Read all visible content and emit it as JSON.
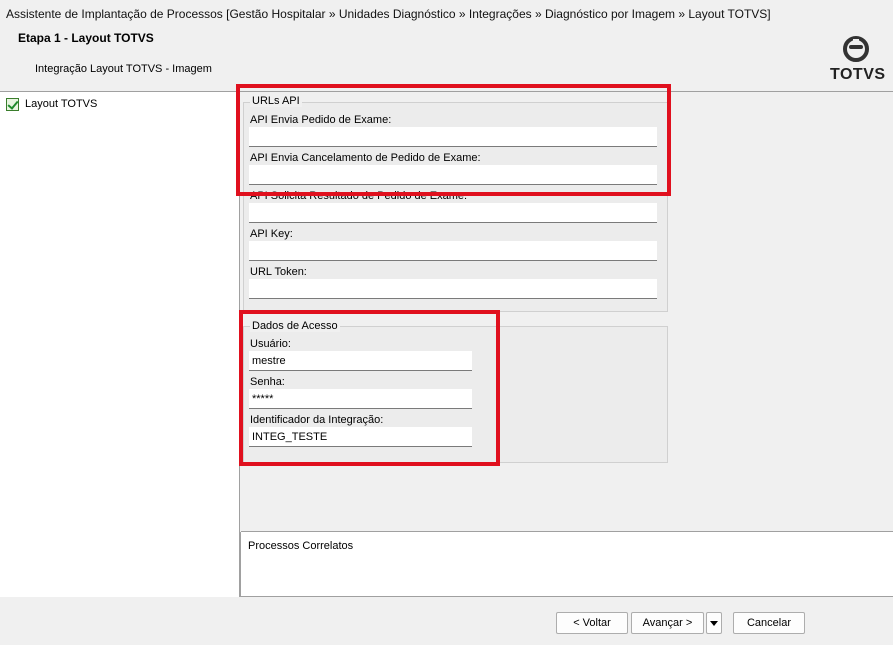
{
  "window": {
    "title": "Assistente de Implantação de Processos [Gestão Hospitalar » Unidades Diagnóstico » Integrações » Diagnóstico por Imagem » Layout TOTVS]"
  },
  "header": {
    "step_title": "Etapa 1 - Layout TOTVS",
    "step_subtitle": "Integração Layout TOTVS - Imagem",
    "logo_text": "TOTVS"
  },
  "sidebar": {
    "items": [
      {
        "label": "Layout TOTVS",
        "icon": "check-icon"
      }
    ]
  },
  "urls_api": {
    "legend": "URLs API",
    "fields": [
      {
        "label": "API Envia Pedido de Exame:",
        "value": ""
      },
      {
        "label": "API Envia Cancelamento de Pedido de Exame:",
        "value": ""
      },
      {
        "label": "API Solicita Resultado de Pedido de Exame:",
        "value": ""
      },
      {
        "label": "API Key:",
        "value": ""
      },
      {
        "label": "URL Token:",
        "value": ""
      }
    ]
  },
  "dados_acesso": {
    "legend": "Dados de Acesso",
    "fields": [
      {
        "label": "Usuário:",
        "value": "mestre"
      },
      {
        "label": "Senha:",
        "value": "*****"
      },
      {
        "label": "Identificador da Integração:",
        "value": "INTEG_TESTE"
      }
    ]
  },
  "related": {
    "label": "Processos Correlatos"
  },
  "footer": {
    "back_label": "< Voltar",
    "next_label": "Avançar >",
    "cancel_label": "Cancelar"
  },
  "highlight_color": "#e0101e"
}
